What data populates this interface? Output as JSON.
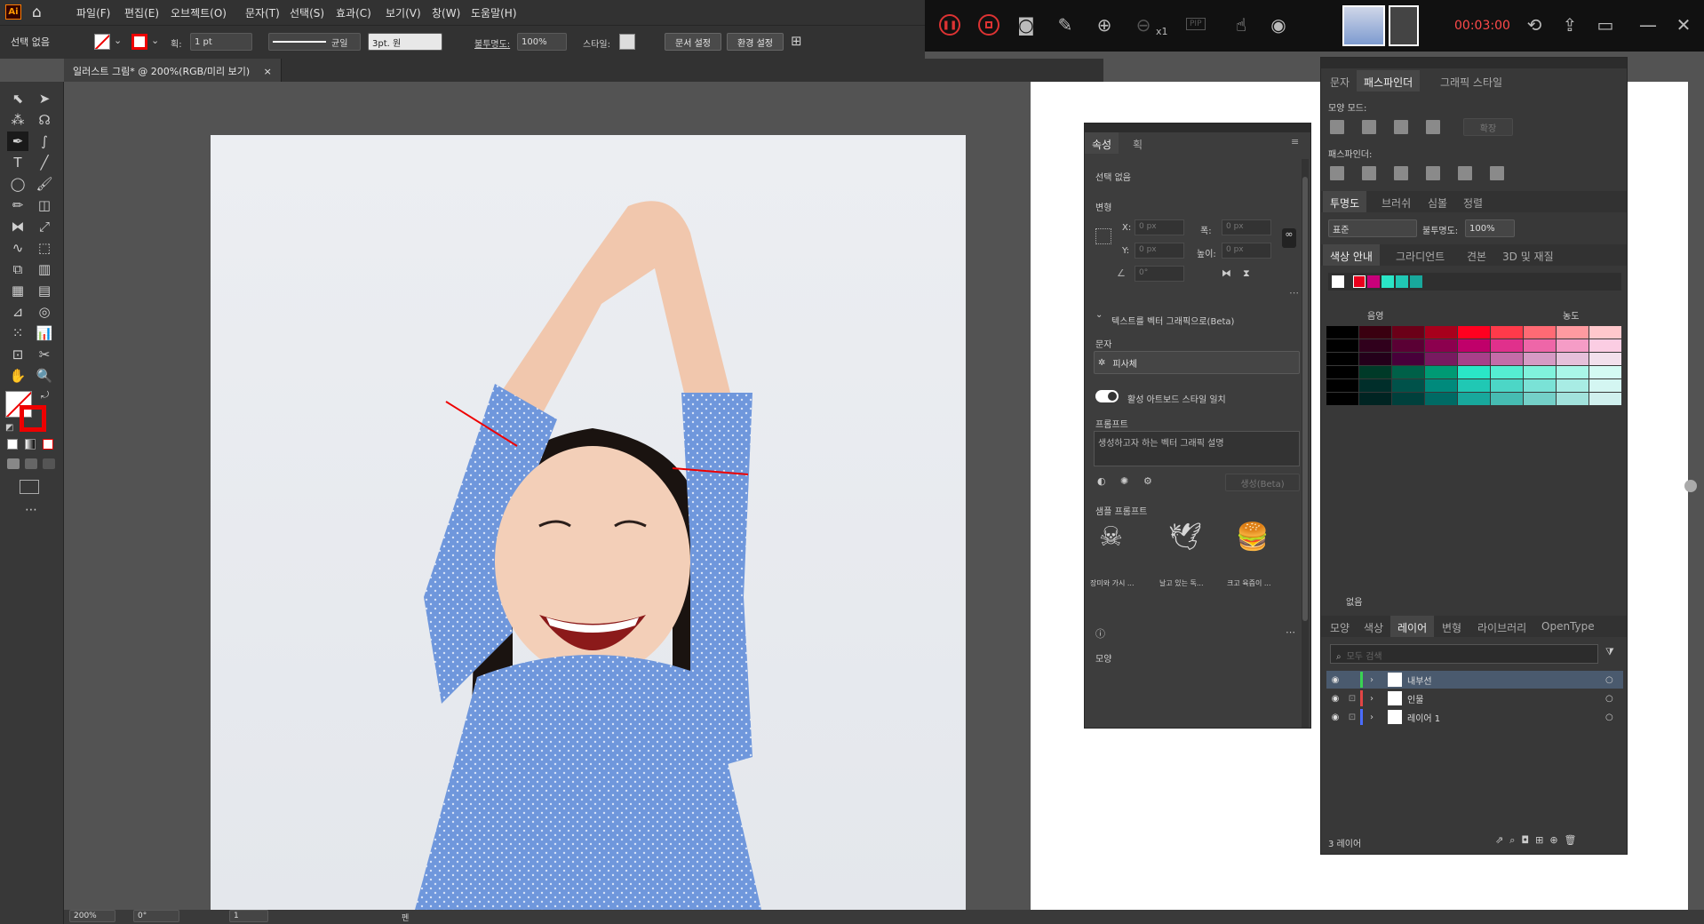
{
  "app": {
    "logo": "Ai",
    "menu": [
      "파일(F)",
      "편집(E)",
      "오브젝트(O)",
      "문자(T)",
      "선택(S)",
      "효과(C)",
      "보기(V)",
      "창(W)",
      "도움말(H)"
    ]
  },
  "control": {
    "selection": "선택 없음",
    "stroke_label": "획:",
    "stroke_weight": "1 pt",
    "stroke_style": "균일",
    "brush": "3pt. 원",
    "opacity_label": "불투명도:",
    "opacity": "100%",
    "style_label": "스타일:",
    "doc_setup": "문서 설정",
    "prefs": "환경 설정"
  },
  "recorder": {
    "timer": "00:03:00",
    "zoom_mult": "x1",
    "pip": "PIP"
  },
  "document": {
    "tab": "일러스트 그림* @ 200%(RGB/미리 보기)",
    "close": "×"
  },
  "status": {
    "zoom": "200%",
    "angle": "0°",
    "page": "1",
    "tool": "펜"
  },
  "properties": {
    "tabs": [
      "속성",
      "획"
    ],
    "none_selected": "선택 없음",
    "transform": "변형",
    "x_label": "X:",
    "y_label": "Y:",
    "w_label": "폭:",
    "h_label": "높이:",
    "x": "0 px",
    "y": "0 px",
    "w": "0 px",
    "h": "0 px",
    "angle": "0°",
    "t2v": "텍스트를 벡터 그래픽으로(Beta)",
    "type_label": "문자",
    "type_value": "피사체",
    "toggle_label": "활성 아트보드 스타일 일치",
    "prompt_label": "프롬프트",
    "prompt_placeholder": "생성하고자 하는 벡터 그래픽 설명",
    "generate": "생성(Beta)",
    "samples_label": "샘플 프롬프트",
    "samples": [
      "장미와 가시 ...",
      "날고 있는 독...",
      "크고 육즙이 ..."
    ],
    "appearance": "모양"
  },
  "pathfinder": {
    "tabs": [
      "문자",
      "패스파인더",
      "그래픽 스타일"
    ],
    "shape_modes": "모양 모드:",
    "expand": "확장",
    "pathfinders": "패스파인더:"
  },
  "transparency": {
    "tabs": [
      "투명도",
      "브러쉬",
      "심볼",
      "정렬"
    ],
    "blend": "표준",
    "opacity_label": "불투명도:",
    "opacity": "100%"
  },
  "colorguide": {
    "tabs": [
      "색상 안내",
      "그라디언트",
      "견본",
      "3D 및 재질"
    ],
    "shade": "음영",
    "tint": "농도",
    "footer_label": "없음",
    "harmony": [
      "#ffffff",
      "#e8001c",
      "#c8007a",
      "#2ae6c7",
      "#20c8b4",
      "#18a89c"
    ],
    "grid_colors": [
      [
        "#000000",
        "#3a0010",
        "#6b0018",
        "#a8001c",
        "#ff0020",
        "#ff3a4a",
        "#ff6a74",
        "#ff9aa0",
        "#ffc8cc"
      ],
      [
        "#000000",
        "#30001c",
        "#5a0034",
        "#8c004e",
        "#c0006a",
        "#e0308c",
        "#ee66a8",
        "#f59cc6",
        "#fbcde3"
      ],
      [
        "#000000",
        "#24001a",
        "#48003a",
        "#781a60",
        "#a8408a",
        "#c46ca8",
        "#d69ac4",
        "#e6c0da",
        "#f2e0ec"
      ],
      [
        "#000000",
        "#003a28",
        "#006048",
        "#009a74",
        "#2ae6c7",
        "#55edd2",
        "#80f2dc",
        "#aaf6e8",
        "#d4faf3"
      ],
      [
        "#000000",
        "#002e2a",
        "#00524a",
        "#008a7c",
        "#20c8b4",
        "#4cd6c6",
        "#7ae2d6",
        "#a8ece4",
        "#d4f6f2"
      ],
      [
        "#000000",
        "#002422",
        "#00403c",
        "#006a64",
        "#18a89c",
        "#46bcb2",
        "#74d0c8",
        "#a2e2dc",
        "#d0f0ee"
      ]
    ]
  },
  "layers": {
    "tabs": [
      "모양",
      "색상",
      "레이어",
      "변형",
      "라이브러리",
      "OpenType"
    ],
    "search_placeholder": "모두 검색",
    "items": [
      {
        "name": "내부선",
        "color": "#39d353"
      },
      {
        "name": "인물",
        "color": "#e24545"
      },
      {
        "name": "레이어 1",
        "color": "#4a6cff"
      }
    ],
    "count": "3 레이어"
  }
}
